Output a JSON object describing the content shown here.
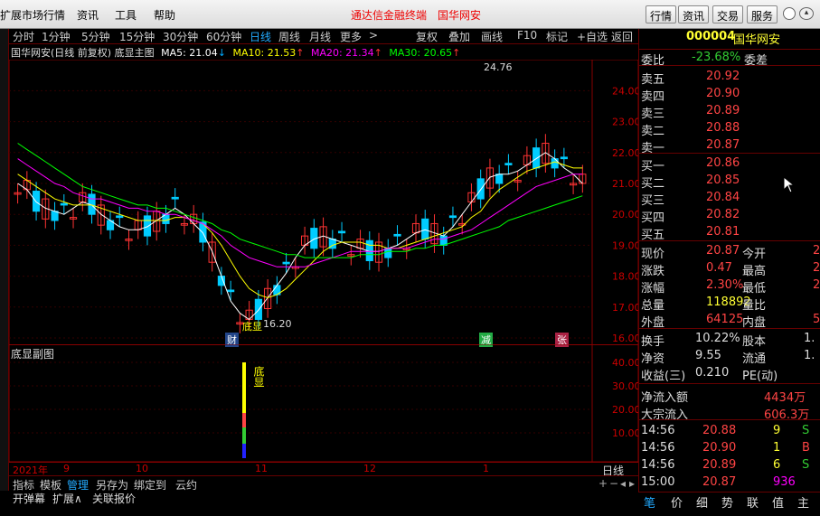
{
  "menu": {
    "items": [
      "扩展市场行情",
      "资讯",
      "工具",
      "帮助"
    ],
    "title_center": "通达信金融终端",
    "title_stock": "国华网安"
  },
  "topbuttons": [
    "行情",
    "资讯",
    "交易",
    "服务"
  ],
  "toolbar": {
    "periods": [
      "分时",
      "1分钟",
      "5分钟",
      "15分钟",
      "30分钟",
      "60分钟",
      "日线",
      "周线",
      "月线",
      "更多"
    ],
    "active": "日线",
    "tools": [
      "复权",
      "叠加",
      "画线",
      "F10",
      "标记",
      "+自选",
      "返回"
    ]
  },
  "main_chart": {
    "name": "国华网安(日线 前复权) 底显主图",
    "ma": [
      {
        "label": "MA5: 21.04",
        "color": "#ffffff"
      },
      {
        "label": "MA10: 21.53",
        "color": "#ffff00"
      },
      {
        "label": "MA20: 21.34",
        "color": "#ff00ff"
      },
      {
        "label": "MA30: 20.65",
        "color": "#00ff00"
      }
    ],
    "high_label": "24.76",
    "low_label": "16.20",
    "low_marker": "底显",
    "event_labels": [
      "财",
      "减",
      "张"
    ]
  },
  "sub_chart": {
    "name": "底显副图",
    "marker": "底显"
  },
  "chart_data": [
    {
      "type": "line",
      "title": "国华网安(日线 前复权) 底显主图",
      "ylim": [
        16,
        24.5
      ],
      "y_ticks": [
        "24.00",
        "23.00",
        "22.00",
        "21.00",
        "20.00",
        "19.00",
        "18.00",
        "17.00",
        "16.00"
      ],
      "series": [
        {
          "name": "MA5",
          "values": [
            21.0,
            20.8,
            20.4,
            20.2,
            20.1,
            20.0,
            20.2,
            20.4,
            20.3,
            20.0,
            19.8,
            19.6,
            19.5,
            19.5,
            19.6,
            19.8,
            20.0,
            20.2,
            20.0,
            19.7,
            19.4,
            18.8,
            18.0,
            17.2,
            16.8,
            16.6,
            16.9,
            17.3,
            17.7,
            18.1,
            18.6,
            19.0,
            19.2,
            19.3,
            19.2,
            19.1,
            19.0,
            18.9,
            18.8,
            18.8,
            18.9,
            19.0,
            19.2,
            19.4,
            19.5,
            19.4,
            19.3,
            19.6,
            20.0,
            20.4,
            20.8,
            21.2,
            21.3,
            21.3,
            21.4,
            21.6,
            21.8,
            22.0,
            21.8,
            21.5,
            21.3,
            21.0
          ]
        },
        {
          "name": "MA10",
          "values": [
            21.3,
            21.1,
            20.9,
            20.7,
            20.5,
            20.4,
            20.3,
            20.3,
            20.3,
            20.2,
            20.1,
            20.0,
            19.9,
            19.8,
            19.8,
            19.8,
            19.8,
            19.9,
            19.9,
            19.8,
            19.7,
            19.4,
            19.0,
            18.5,
            18.0,
            17.6,
            17.4,
            17.3,
            17.4,
            17.6,
            17.9,
            18.2,
            18.5,
            18.8,
            19.0,
            19.1,
            19.1,
            19.1,
            19.0,
            19.0,
            18.9,
            18.9,
            19.0,
            19.1,
            19.2,
            19.3,
            19.4,
            19.5,
            19.6,
            19.9,
            20.1,
            20.5,
            20.8,
            21.0,
            21.2,
            21.4,
            21.5,
            21.6,
            21.7,
            21.6,
            21.5,
            21.5
          ]
        },
        {
          "name": "MA20",
          "values": [
            21.8,
            21.6,
            21.4,
            21.2,
            21.0,
            20.9,
            20.7,
            20.6,
            20.5,
            20.5,
            20.4,
            20.3,
            20.2,
            20.2,
            20.1,
            20.1,
            20.0,
            20.0,
            19.9,
            19.8,
            19.7,
            19.5,
            19.3,
            19.0,
            18.8,
            18.6,
            18.5,
            18.4,
            18.3,
            18.3,
            18.3,
            18.3,
            18.4,
            18.5,
            18.6,
            18.7,
            18.8,
            18.8,
            18.8,
            18.8,
            18.9,
            18.9,
            18.9,
            19.0,
            19.1,
            19.2,
            19.2,
            19.3,
            19.4,
            19.5,
            19.7,
            19.9,
            20.1,
            20.3,
            20.5,
            20.7,
            20.9,
            21.0,
            21.1,
            21.2,
            21.3,
            21.3
          ]
        },
        {
          "name": "MA30",
          "values": [
            22.3,
            22.1,
            21.9,
            21.7,
            21.5,
            21.3,
            21.1,
            20.9,
            20.8,
            20.7,
            20.6,
            20.5,
            20.4,
            20.3,
            20.3,
            20.2,
            20.2,
            20.1,
            20.0,
            19.9,
            19.8,
            19.7,
            19.5,
            19.4,
            19.2,
            19.1,
            19.0,
            18.9,
            18.8,
            18.7,
            18.7,
            18.6,
            18.6,
            18.6,
            18.6,
            18.6,
            18.6,
            18.7,
            18.7,
            18.7,
            18.8,
            18.8,
            18.8,
            18.9,
            18.9,
            19.0,
            19.0,
            19.1,
            19.2,
            19.3,
            19.4,
            19.5,
            19.6,
            19.8,
            19.9,
            20.0,
            20.1,
            20.2,
            20.3,
            20.4,
            20.5,
            20.6
          ]
        }
      ]
    },
    {
      "type": "bar",
      "title": "底显副图",
      "y_ticks": [
        "40.00",
        "30.00",
        "20.00",
        "10.00"
      ]
    }
  ],
  "x_axis": [
    "2021年",
    "9",
    "10",
    "11",
    "12",
    "1"
  ],
  "period_label": "日线",
  "bottom_tabs": [
    "指标",
    "模板",
    "管理",
    "另存为",
    "绑定到",
    "云约"
  ],
  "status": [
    "开弹幕",
    "扩展∧",
    "关联报价"
  ],
  "quote": {
    "code": "000004",
    "name": "国华网安",
    "weibi": {
      "label": "委比",
      "value": "-23.68%",
      "label2": "委差"
    },
    "sell": [
      {
        "l": "卖五",
        "p": "20.92"
      },
      {
        "l": "卖四",
        "p": "20.90"
      },
      {
        "l": "卖三",
        "p": "20.89"
      },
      {
        "l": "卖二",
        "p": "20.88"
      },
      {
        "l": "卖一",
        "p": "20.87"
      }
    ],
    "buy": [
      {
        "l": "买一",
        "p": "20.86"
      },
      {
        "l": "买二",
        "p": "20.85"
      },
      {
        "l": "买三",
        "p": "20.84"
      },
      {
        "l": "买四",
        "p": "20.82"
      },
      {
        "l": "买五",
        "p": "20.81"
      }
    ],
    "stats": [
      {
        "l": "现价",
        "v": "20.87",
        "vc": "r",
        "l2": "今开",
        "v2": "2"
      },
      {
        "l": "涨跌",
        "v": "0.47",
        "vc": "r",
        "l2": "最高",
        "v2": "2"
      },
      {
        "l": "涨幅",
        "v": "2.30%",
        "vc": "r",
        "l2": "最低",
        "v2": "2"
      },
      {
        "l": "总量",
        "v": "118892",
        "vc": "y",
        "l2": "量比",
        "v2": ""
      },
      {
        "l": "外盘",
        "v": "64125",
        "vc": "r",
        "l2": "内盘",
        "v2": "5"
      }
    ],
    "stats2": [
      {
        "l": "换手",
        "v": "10.22%",
        "l2": "股本",
        "v2": "1."
      },
      {
        "l": "净资",
        "v": "9.55",
        "l2": "流通",
        "v2": "1."
      },
      {
        "l": "收益(三)",
        "v": "0.210",
        "l2": "PE(动)",
        "v2": ""
      }
    ],
    "flow": [
      {
        "l": "净流入额",
        "v": "4434万"
      },
      {
        "l": "大宗流入",
        "v": "606.3万"
      }
    ],
    "ticks": [
      {
        "t": "14:56",
        "p": "20.88",
        "n": "9",
        "d": "S",
        "dc": "g"
      },
      {
        "t": "14:56",
        "p": "20.90",
        "n": "1",
        "d": "B",
        "dc": "r"
      },
      {
        "t": "14:56",
        "p": "20.89",
        "n": "6",
        "d": "S",
        "dc": "g"
      },
      {
        "t": "15:00",
        "p": "20.87",
        "n": "936",
        "d": "",
        "dc": "m"
      }
    ],
    "tabs": [
      "笔",
      "价",
      "细",
      "势",
      "联",
      "值",
      "主"
    ]
  }
}
